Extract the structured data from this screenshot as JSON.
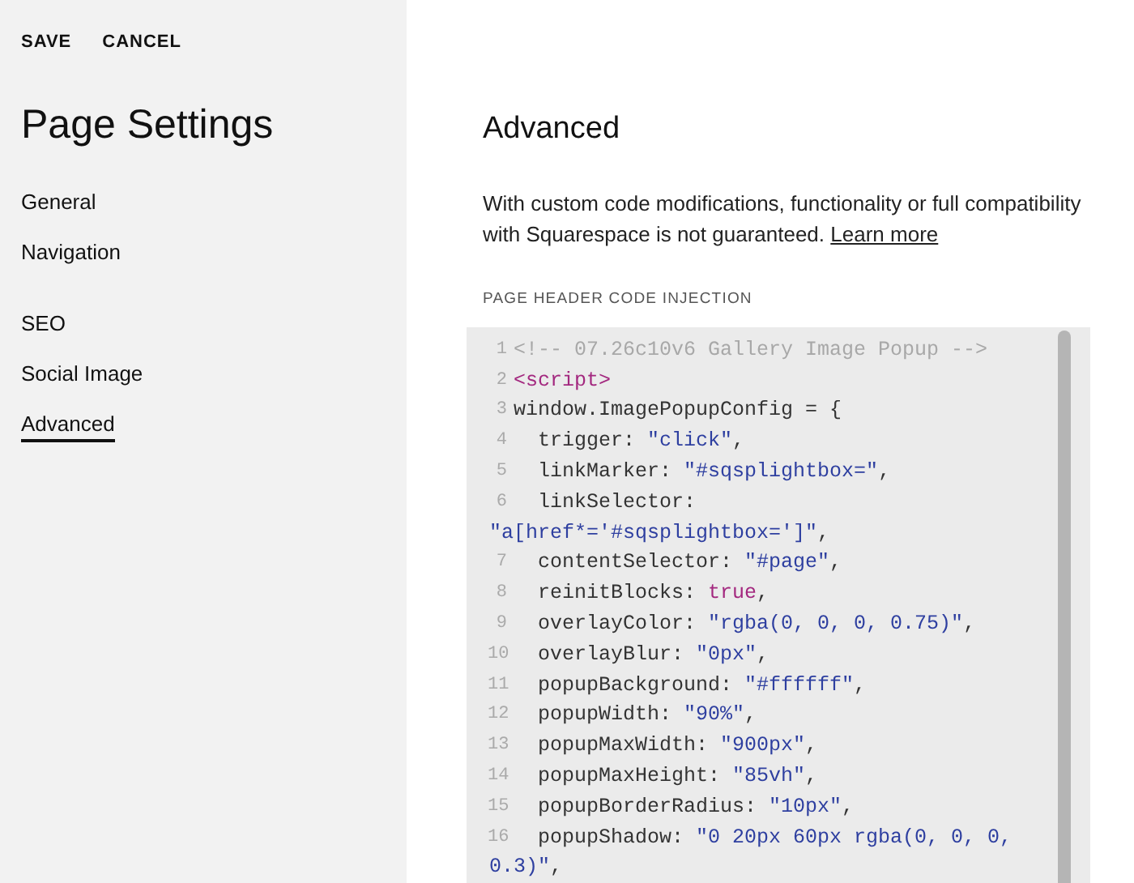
{
  "sidebar": {
    "actions": [
      "SAVE",
      "CANCEL"
    ],
    "title": "Page Settings",
    "groups": [
      [
        {
          "label": "General",
          "selected": false
        },
        {
          "label": "Navigation",
          "selected": false
        }
      ],
      [
        {
          "label": "SEO",
          "selected": false
        },
        {
          "label": "Social Image",
          "selected": false
        },
        {
          "label": "Advanced",
          "selected": true
        }
      ]
    ]
  },
  "main": {
    "heading": "Advanced",
    "description": "With custom code modifications, functionality or full compatibility with Squarespace is not guaranteed.",
    "link": "Learn more",
    "field_label": "PAGE HEADER CODE INJECTION",
    "code_lines": [
      {
        "number": "1",
        "segments": [
          {
            "kind": "comment",
            "text": "<!-- 07.26c10v6 Gallery Image Popup -->"
          }
        ]
      },
      {
        "number": "2",
        "segments": [
          {
            "kind": "tag",
            "text": "<script>"
          }
        ]
      },
      {
        "number": "3",
        "segments": [
          {
            "kind": "plain",
            "text": "window.ImagePopupConfig = {"
          }
        ]
      },
      {
        "number": "4",
        "segments": [
          {
            "kind": "plain",
            "text": "  trigger: "
          },
          {
            "kind": "string",
            "text": "\"click\""
          },
          {
            "kind": "plain",
            "text": ","
          }
        ]
      },
      {
        "number": "5",
        "segments": [
          {
            "kind": "plain",
            "text": "  linkMarker: "
          },
          {
            "kind": "string",
            "text": "\"#sqsplightbox=\""
          },
          {
            "kind": "plain",
            "text": ","
          }
        ]
      },
      {
        "number": "6",
        "segments": [
          {
            "kind": "plain",
            "text": "  linkSelector:"
          }
        ],
        "wrapped": [
          {
            "kind": "string",
            "text": "\"a[href*='#sqsplightbox=']\""
          },
          {
            "kind": "plain",
            "text": ","
          }
        ]
      },
      {
        "number": "7",
        "segments": [
          {
            "kind": "plain",
            "text": "  contentSelector: "
          },
          {
            "kind": "string",
            "text": "\"#page\""
          },
          {
            "kind": "plain",
            "text": ","
          }
        ]
      },
      {
        "number": "8",
        "segments": [
          {
            "kind": "plain",
            "text": "  reinitBlocks: "
          },
          {
            "kind": "keyword",
            "text": "true"
          },
          {
            "kind": "plain",
            "text": ","
          }
        ]
      },
      {
        "number": "9",
        "segments": [
          {
            "kind": "plain",
            "text": "  overlayColor: "
          },
          {
            "kind": "string",
            "text": "\"rgba(0, 0, 0, 0.75)\""
          },
          {
            "kind": "plain",
            "text": ","
          }
        ]
      },
      {
        "number": "10",
        "segments": [
          {
            "kind": "plain",
            "text": "  overlayBlur: "
          },
          {
            "kind": "string",
            "text": "\"0px\""
          },
          {
            "kind": "plain",
            "text": ","
          }
        ]
      },
      {
        "number": "11",
        "segments": [
          {
            "kind": "plain",
            "text": "  popupBackground: "
          },
          {
            "kind": "string",
            "text": "\"#ffffff\""
          },
          {
            "kind": "plain",
            "text": ","
          }
        ]
      },
      {
        "number": "12",
        "segments": [
          {
            "kind": "plain",
            "text": "  popupWidth: "
          },
          {
            "kind": "string",
            "text": "\"90%\""
          },
          {
            "kind": "plain",
            "text": ","
          }
        ]
      },
      {
        "number": "13",
        "segments": [
          {
            "kind": "plain",
            "text": "  popupMaxWidth: "
          },
          {
            "kind": "string",
            "text": "\"900px\""
          },
          {
            "kind": "plain",
            "text": ","
          }
        ]
      },
      {
        "number": "14",
        "segments": [
          {
            "kind": "plain",
            "text": "  popupMaxHeight: "
          },
          {
            "kind": "string",
            "text": "\"85vh\""
          },
          {
            "kind": "plain",
            "text": ","
          }
        ]
      },
      {
        "number": "15",
        "segments": [
          {
            "kind": "plain",
            "text": "  popupBorderRadius: "
          },
          {
            "kind": "string",
            "text": "\"10px\""
          },
          {
            "kind": "plain",
            "text": ","
          }
        ]
      },
      {
        "number": "16",
        "segments": [
          {
            "kind": "plain",
            "text": "  popupShadow: "
          },
          {
            "kind": "string",
            "text": "\"0 20px 60px rgba(0, 0, 0,"
          }
        ],
        "wrapped": [
          {
            "kind": "string",
            "text": "0.3)\""
          },
          {
            "kind": "plain",
            "text": ","
          }
        ]
      }
    ]
  }
}
